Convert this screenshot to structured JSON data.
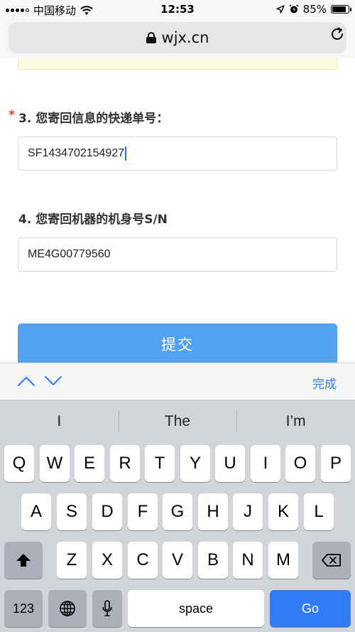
{
  "status_bar": {
    "carrier": "中国移动",
    "time": "12:53",
    "battery_percent": "85%",
    "battery_level": 0.85
  },
  "browser": {
    "url": "wjx.cn"
  },
  "form": {
    "q3": {
      "required_mark": "*",
      "title": "3. 您寄回信息的快递单号：",
      "value": "SF1434702154927"
    },
    "q4": {
      "title": "4. 您寄回机器的机身号S/N",
      "value": "ME4G00779560"
    },
    "submit_label": "提交"
  },
  "assistant_bar": {
    "done_label": "完成"
  },
  "keyboard": {
    "suggestions": [
      "I",
      "The",
      "I’m"
    ],
    "row1": [
      "Q",
      "W",
      "E",
      "R",
      "T",
      "Y",
      "U",
      "I",
      "O",
      "P"
    ],
    "row2": [
      "A",
      "S",
      "D",
      "F",
      "G",
      "H",
      "J",
      "K",
      "L"
    ],
    "row3": [
      "Z",
      "X",
      "C",
      "V",
      "B",
      "N",
      "M"
    ],
    "numbers_label": "123",
    "space_label": "space",
    "go_label": "Go"
  }
}
